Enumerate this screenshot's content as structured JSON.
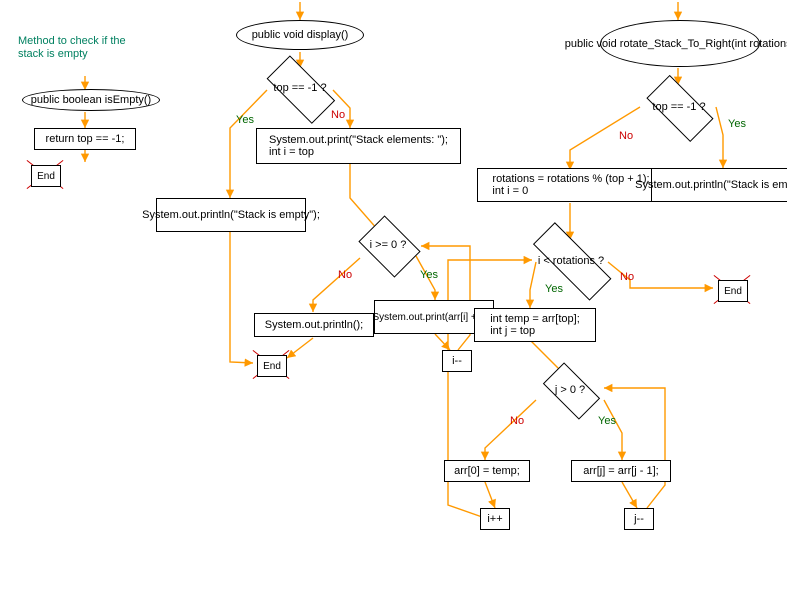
{
  "comment1": "Method to check if the stack is empty",
  "col1": {
    "method": "public boolean isEmpty()",
    "ret": "return top == -1;",
    "end": "End"
  },
  "col2": {
    "method": "public void display()",
    "cond1": "top == -1 ?",
    "yes": "Yes",
    "no": "No",
    "trueBranch": "System.out.println(\"Stack is empty\");",
    "falseBranch": "System.out.print(\"Stack elements: \");\nint i = top",
    "cond2": "i >= 0 ?",
    "loopBody": "System.out.print(arr[i] + \" \");",
    "decrement": "i--",
    "afterLoop": "System.out.println();",
    "end": "End"
  },
  "col3": {
    "method": "public void rotate_Stack_To_Right(int rotations)",
    "cond1": "top == -1 ?",
    "yes": "Yes",
    "no": "No",
    "empty": "System.out.println(\"Stack is empty\");",
    "init": "rotations = rotations % (top + 1);\nint i = 0",
    "cond2": "i < rotations ?",
    "loopInit": "int temp = arr[top];\nint j = top",
    "cond3": "j > 0 ?",
    "innerYes": "arr[j] = arr[j - 1];",
    "innerNo": "arr[0] = temp;",
    "jdec": "j--",
    "iinc": "i++",
    "end": "End"
  }
}
